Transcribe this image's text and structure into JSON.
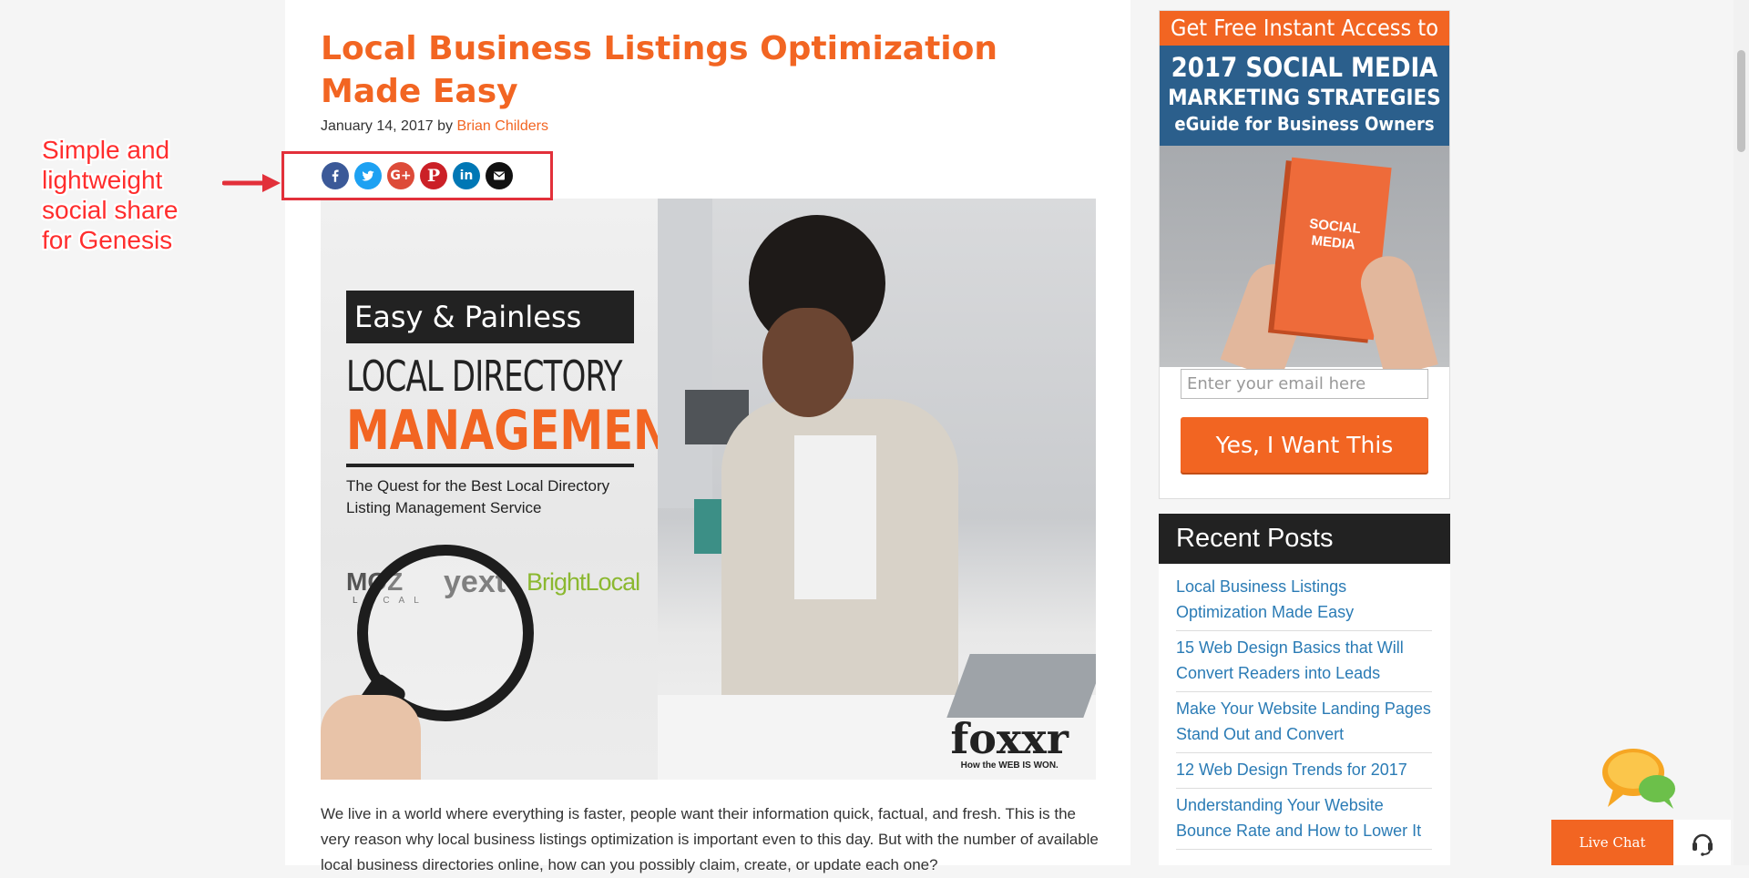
{
  "post": {
    "title": "Local Business Listings Optimization Made Easy",
    "date": "January 14, 2017",
    "by": "by",
    "author": "Brian Childers",
    "body": "We live in a world where everything is faster, people want their information quick, factual, and fresh. This is the very reason why local business listings optimization is important even to this day. But with the number of available local business directories online, how can you possibly claim, create, or update each one?"
  },
  "share": {
    "buttons": [
      {
        "name": "facebook",
        "icon": "facebook-icon",
        "color": "#3b5998"
      },
      {
        "name": "twitter",
        "icon": "twitter-icon",
        "color": "#1da1f2"
      },
      {
        "name": "google-plus",
        "icon": "google-plus-icon",
        "color": "#dd4b39"
      },
      {
        "name": "pinterest",
        "icon": "pinterest-icon",
        "color": "#cb2027"
      },
      {
        "name": "linkedin",
        "icon": "linkedin-icon",
        "color": "#0077b5"
      },
      {
        "name": "email",
        "icon": "email-icon",
        "color": "#111111"
      }
    ]
  },
  "annotation": {
    "text": "Simple and lightweight social share for Genesis",
    "color": "#ff2d2d"
  },
  "featured_image": {
    "banner": "Easy & Painless",
    "heading_1": "LOCAL DIRECTORY",
    "heading_2": "MANAGEMENT",
    "subtitle": "The Quest for the Best Local Directory Listing Management Service",
    "logos": [
      "MOZ",
      "LOCAL",
      "yext",
      "BrightLocal"
    ],
    "brand": "foxxr",
    "brand_tagline": "How the WEB IS WON."
  },
  "optin": {
    "headline": "Get Free Instant Access to Our",
    "title_line_1": "2017 SOCIAL MEDIA",
    "title_line_2": "MARKETING STRATEGIES",
    "title_line_3": "eGuide for Business Owners",
    "ebook_title": "SOCIAL MEDIA",
    "email_placeholder": "Enter your email here",
    "button_label": "Yes, I Want This"
  },
  "recent_posts": {
    "title": "Recent Posts",
    "items": [
      "Local Business Listings Optimization Made Easy",
      "15 Web Design Basics that Will Convert Readers into Leads",
      "Make Your Website Landing Pages Stand Out and Convert",
      "12 Web Design Trends for 2017",
      "Understanding Your Website Bounce Rate and How to Lower It"
    ]
  },
  "live_chat": {
    "label": "Live Chat"
  },
  "colors": {
    "accent": "#f26522",
    "link": "#2a7bb5",
    "optin_blue": "#2b5f8c"
  }
}
